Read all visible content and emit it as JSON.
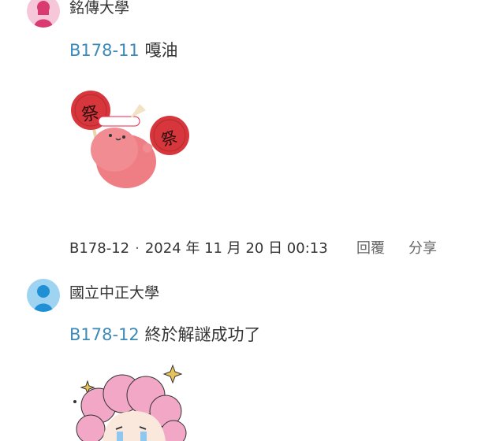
{
  "comments": [
    {
      "school": "銘傳大學",
      "avatar_color": "#e0407a",
      "ref": "B178-11",
      "text": "嘎油",
      "sticker": {
        "sign1": "祭",
        "sign2": "祭"
      }
    },
    {
      "school": "國立中正大學",
      "avatar_color": "#3aa6e6",
      "ref": "B178-12",
      "text": "終於解謎成功了"
    }
  ],
  "meta_row": {
    "id": "B178-12",
    "dot": "·",
    "timestamp": "2024 年 11 月 20 日 00:13",
    "reply_label": "回覆",
    "share_label": "分享"
  }
}
